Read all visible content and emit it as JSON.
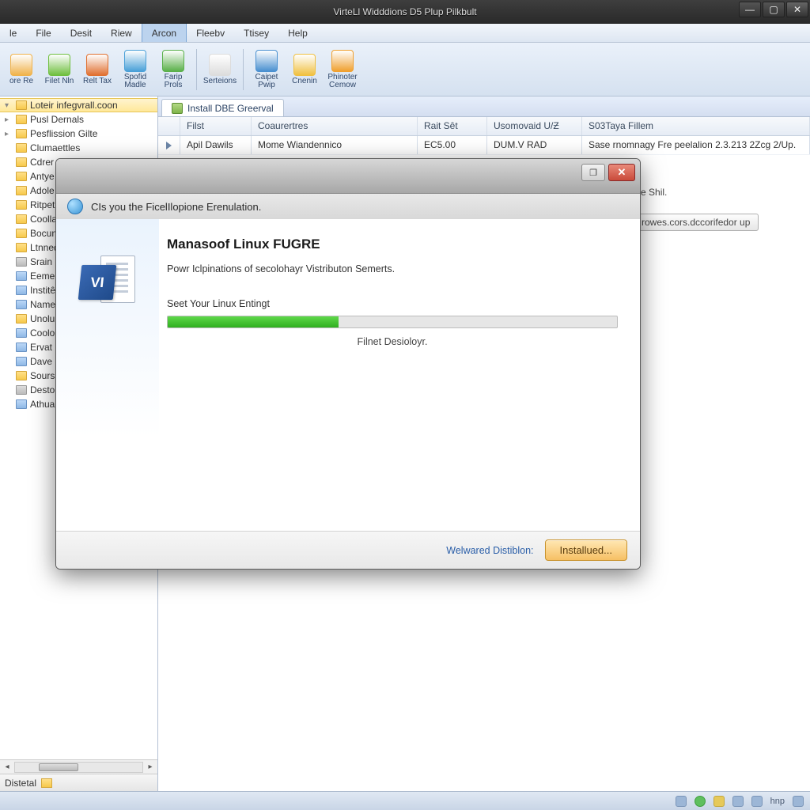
{
  "window": {
    "title": "VirteLl Widddions D5 Plup Pilkbult"
  },
  "menu": [
    "le",
    "File",
    "Desit",
    "Riew",
    "Arcon",
    "Fleebv",
    "Ttisey",
    "Help"
  ],
  "menu_active_index": 4,
  "toolbar": [
    {
      "label": "ore Re",
      "color": "#f0b24a"
    },
    {
      "label": "Filet Nln",
      "color": "#6fbf3f"
    },
    {
      "label": "Relt Tax",
      "color": "#e07030"
    },
    {
      "label": "Spofid Madle",
      "color": "#4aa0d8"
    },
    {
      "label": "Farip Prols",
      "color": "#5ab04a"
    },
    {
      "sep": true
    },
    {
      "label": "Serteions",
      "color": "#dcdcdc"
    },
    {
      "sep": true
    },
    {
      "label": "Caipet Pwip",
      "color": "#4a90d0"
    },
    {
      "label": "Cnenin",
      "color": "#f0c040"
    },
    {
      "label": "Phinoter Cemow",
      "color": "#f0a030"
    }
  ],
  "tree": [
    {
      "label": "Loteir infegvrall.coon",
      "sel": true,
      "icon": "yellow",
      "exp": "▾"
    },
    {
      "label": "Pusl Dernals",
      "icon": "yellow",
      "exp": "▸"
    },
    {
      "label": "Pesflission Gilte",
      "icon": "yellow",
      "exp": "▸"
    },
    {
      "label": "Clumaettles",
      "icon": "yellow"
    },
    {
      "label": "Cdrer",
      "icon": "yellow"
    },
    {
      "label": "Antye",
      "icon": "yellow"
    },
    {
      "label": "Adole",
      "icon": "yellow"
    },
    {
      "label": "Ritpet",
      "icon": "yellow"
    },
    {
      "label": "Coolla",
      "icon": "yellow"
    },
    {
      "label": "Bocun",
      "icon": "yellow"
    },
    {
      "label": "Ltnned",
      "icon": "yellow"
    },
    {
      "label": "Srain",
      "icon": "gray"
    },
    {
      "label": "Eemei",
      "icon": "blue"
    },
    {
      "label": "Institê",
      "icon": "blue"
    },
    {
      "label": "Name",
      "icon": "blue"
    },
    {
      "label": "Unolu",
      "icon": "yellow"
    },
    {
      "label": "Coolo",
      "icon": "blue"
    },
    {
      "label": "Ervat",
      "icon": "blue"
    },
    {
      "label": "Dave",
      "icon": "blue"
    },
    {
      "label": "Sourss",
      "icon": "yellow"
    },
    {
      "label": "Desto",
      "icon": "gray"
    },
    {
      "label": "Athua",
      "icon": "blue"
    }
  ],
  "sidebar_footer": "Distetal",
  "tab": {
    "label": "Install DBE Greerval"
  },
  "columns": [
    "",
    "Filst",
    "Coaurertres",
    "Rait Sêt",
    "Usomovaid U/Ƶ",
    "S03Taya Fillem"
  ],
  "row": [
    "",
    "Apil Dawils",
    "Mome Wiandennico",
    "EC5.00",
    "DUM.V RAD",
    "Sase rnomnagy Fre peelalion 2.3.213 2Zcg 2/Up."
  ],
  "detail": {
    "line1": "ate Shil.",
    "button": "rowes.cors.dccorifedor up"
  },
  "dialog": {
    "instruction": "CIs you the FicelIlopione Erenulation.",
    "heading": "Manasoof Linux FUGRE",
    "subheading": "Powr Iclpinations of secolohayr Vistributon Semerts.",
    "step": "Seet Your Linux Entingt",
    "progress_pct": 38,
    "progress_label": "Filnet Desioloyr.",
    "footer_link": "Welwared Distiblon:",
    "footer_button": "Installued...",
    "badge": "VI"
  },
  "status_text": "hnp"
}
